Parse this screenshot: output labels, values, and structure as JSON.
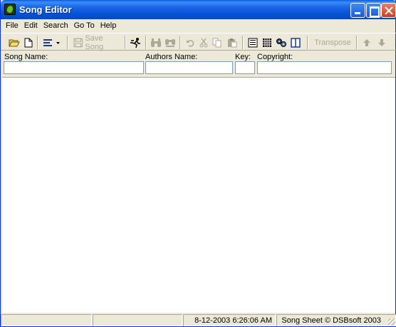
{
  "window": {
    "title": "Song Editor"
  },
  "menu": [
    "File",
    "Edit",
    "Search",
    "Go To",
    "Help"
  ],
  "toolbar": {
    "save_song": "Save Song",
    "transpose": "Transpose"
  },
  "fields": {
    "song_name_label": "Song Name:",
    "authors_name_label": "Authors Name:",
    "key_label": "Key:",
    "copyright_label": "Copyright:",
    "song_name_value": "",
    "authors_name_value": "",
    "key_value": "",
    "copyright_value": ""
  },
  "editor": {
    "content": ""
  },
  "status": {
    "panel1": "",
    "panel2": "",
    "datetime": "8-12-2003   6:26:06 AM",
    "copyright": "Song Sheet © DSBsoft 2003"
  },
  "colors": {
    "titlebar": "#0553d6",
    "chrome": "#ece9d8",
    "field_border": "#7f9db9",
    "disabled": "#aca899"
  }
}
